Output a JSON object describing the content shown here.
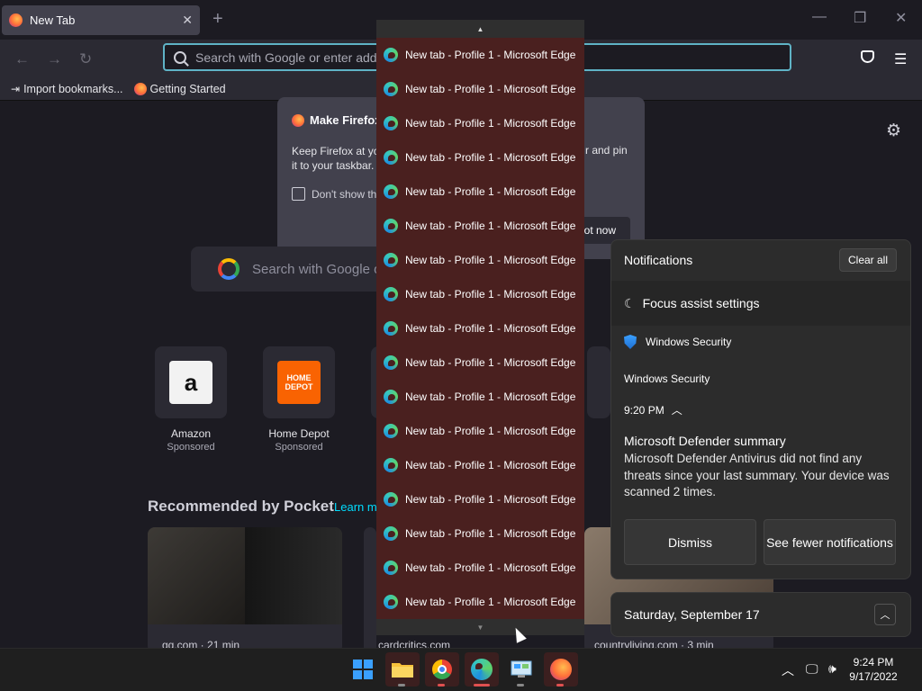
{
  "browser": {
    "tab_title": "New Tab",
    "url_placeholder": "Search with Google or enter addr",
    "bookmarks": [
      "Import bookmarks...",
      "Getting Started"
    ]
  },
  "modal": {
    "title": "Make Firefox y",
    "text_left": "Keep Firefox at yo",
    "text_line2": "it to your taskbar.",
    "text_right": "r and pin",
    "checkbox_label": "Don't show th",
    "button_label": "ot now"
  },
  "newtab": {
    "search_placeholder": "Search with Google or",
    "tiles": [
      {
        "label": "Amazon",
        "sub": "Sponsored"
      },
      {
        "label": "Home Depot",
        "sub": "Sponsored"
      }
    ],
    "pocket_heading": "Recommended by Pocket",
    "pocket_learn": "Learn m",
    "cards": [
      "gq.com · 21 min",
      "cardcritics.com",
      "countryliving.com · 3 min"
    ]
  },
  "jumplist": {
    "items": [
      "New tab - Profile 1 - Microsoft Edge",
      "New tab - Profile 1 - Microsoft Edge",
      "New tab - Profile 1 - Microsoft Edge",
      "New tab - Profile 1 - Microsoft Edge",
      "New tab - Profile 1 - Microsoft Edge",
      "New tab - Profile 1 - Microsoft Edge",
      "New tab - Profile 1 - Microsoft Edge",
      "New tab - Profile 1 - Microsoft Edge",
      "New tab - Profile 1 - Microsoft Edge",
      "New tab - Profile 1 - Microsoft Edge",
      "New tab - Profile 1 - Microsoft Edge",
      "New tab - Profile 1 - Microsoft Edge",
      "New tab - Profile 1 - Microsoft Edge",
      "New tab - Profile 1 - Microsoft Edge",
      "New tab - Profile 1 - Microsoft Edge",
      "New tab - Profile 1 - Microsoft Edge",
      "New tab - Profile 1 - Microsoft Edge"
    ]
  },
  "notifications": {
    "header": "Notifications",
    "clear_all": "Clear all",
    "focus_assist": "Focus assist settings",
    "app_name": "Windows Security",
    "group_name": "Windows Security",
    "time": "9:20 PM",
    "title": "Microsoft Defender summary",
    "body": "Microsoft Defender Antivirus did not find any threats since your last summary. Your device was scanned 2 times.",
    "dismiss": "Dismiss",
    "see_fewer": "See fewer notifications"
  },
  "calendar": {
    "date": "Saturday, September 17"
  },
  "taskbar": {
    "time": "9:24 PM",
    "date": "9/17/2022",
    "apps": [
      "start-icon",
      "file-explorer-icon",
      "chrome-icon",
      "edge-icon",
      "control-panel-icon",
      "firefox-icon"
    ]
  },
  "colors": {
    "jumplist_bg": "#4a201f",
    "url_focus": "#5fb3c6",
    "firefox_bg": "#1c1b22"
  }
}
